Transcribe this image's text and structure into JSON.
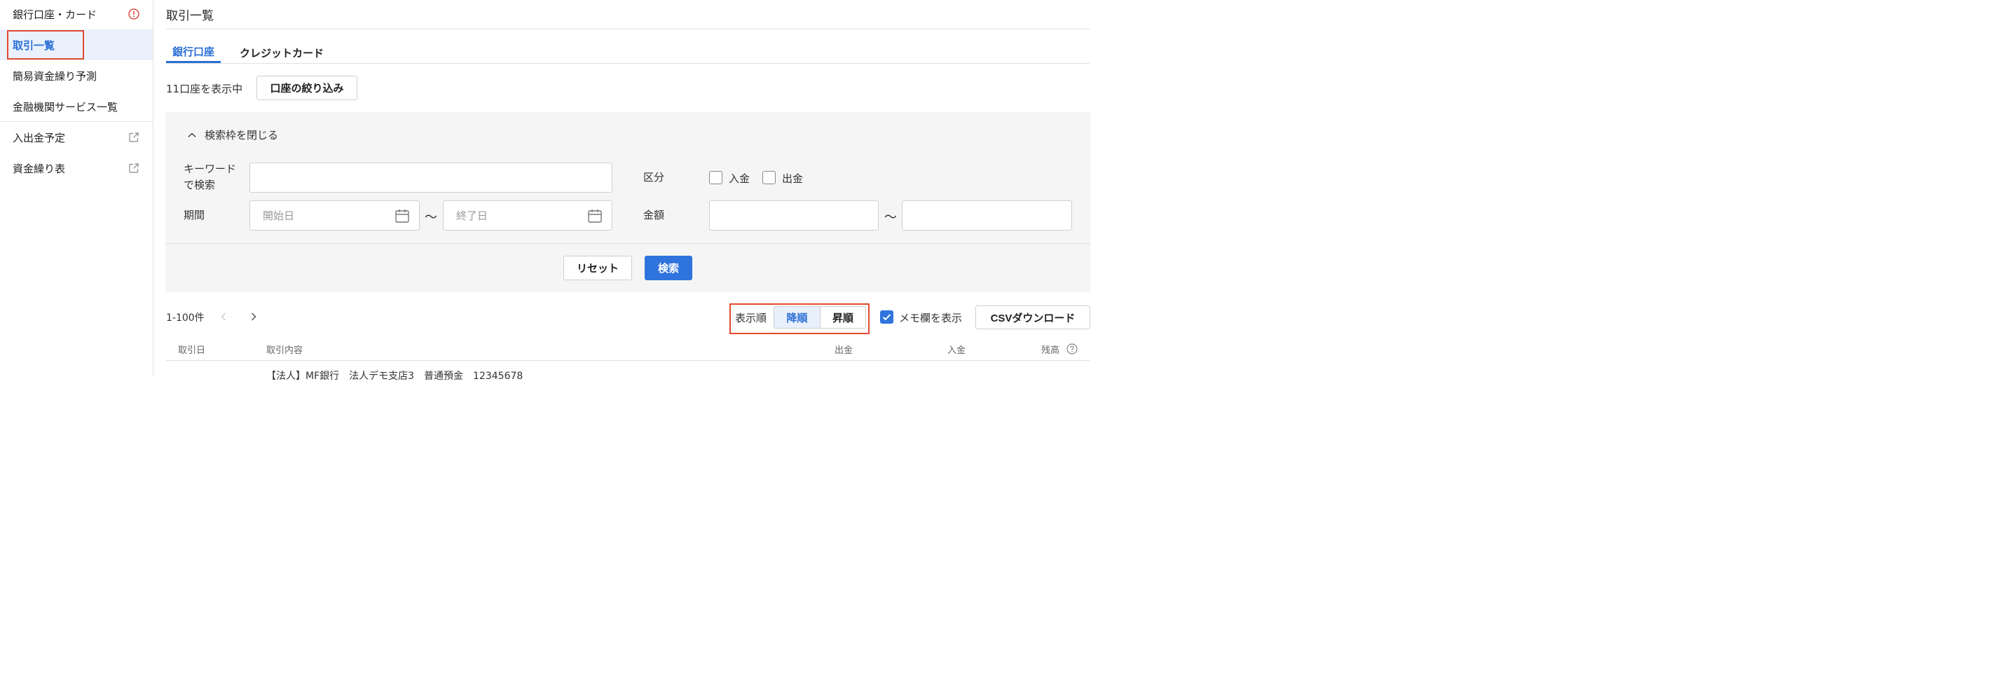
{
  "sidebar": {
    "items": [
      {
        "label": "銀行口座・カード",
        "icon": "alert-circle-icon"
      },
      {
        "label": "取引一覧"
      },
      {
        "label": "簡易資金繰り予測"
      },
      {
        "label": "金融機関サービス一覧"
      },
      {
        "label": "入出金予定",
        "icon": "external-link-icon"
      },
      {
        "label": "資金繰り表",
        "icon": "external-link-icon"
      }
    ]
  },
  "page": {
    "title": "取引一覧"
  },
  "tabs": [
    {
      "label": "銀行口座"
    },
    {
      "label": "クレジットカード"
    }
  ],
  "accounts": {
    "count_label": "11口座を表示中",
    "filter_button": "口座の絞り込み"
  },
  "search": {
    "collapse_label": "検索枠を閉じる",
    "keyword_label_line1": "キーワード",
    "keyword_label_line2": "で検索",
    "keyword_value": "",
    "period_label": "期間",
    "start_placeholder": "開始日",
    "end_placeholder": "終了日",
    "tilde": "〜",
    "category_label": "区分",
    "deposit_label": "入金",
    "withdrawal_label": "出金",
    "amount_label": "金額",
    "reset_button": "リセット",
    "search_button": "検索"
  },
  "results": {
    "range_label": "1-100件",
    "sort_label": "表示順",
    "sort_desc": "降順",
    "sort_asc": "昇順",
    "memo_label": "メモ欄を表示",
    "memo_checked": true,
    "csv_button": "CSVダウンロード"
  },
  "table": {
    "columns": [
      "取引日",
      "取引内容",
      "出金",
      "入金",
      "残高"
    ],
    "rows": [
      {
        "description": "【法人】MF銀行　法人デモ支店3　普通預金　12345678"
      }
    ]
  },
  "colors": {
    "accent": "#2f73dd",
    "highlight": "#e24a2e",
    "alert": "#d93025"
  }
}
